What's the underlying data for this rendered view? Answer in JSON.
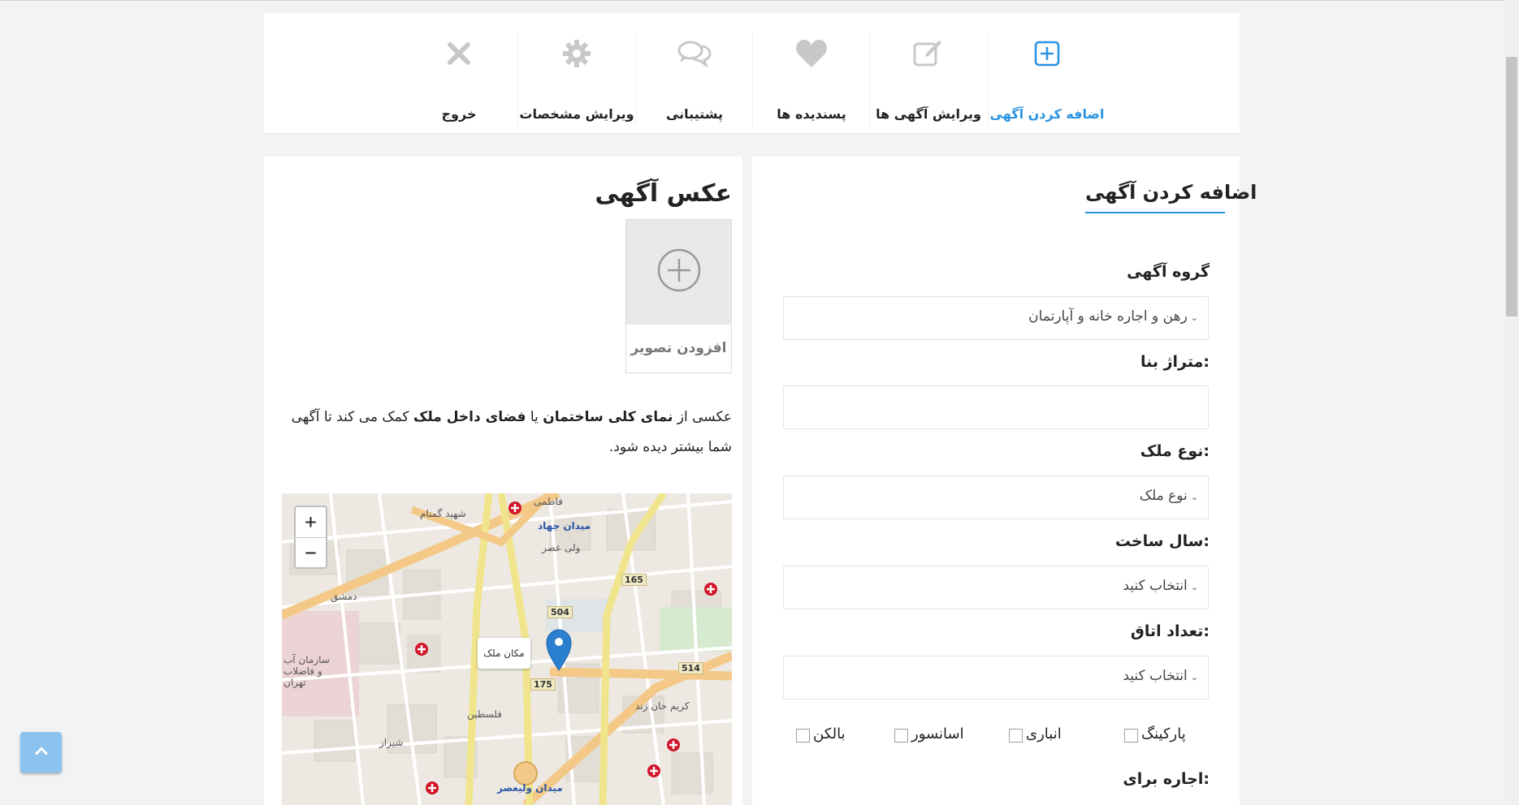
{
  "nav": {
    "items": [
      {
        "label": "اضافه کردن آگهی",
        "icon": "plus-square-icon",
        "active": true
      },
      {
        "label": "ویرایش آگهی ها",
        "icon": "edit-icon",
        "active": false
      },
      {
        "label": "پسندیده ها",
        "icon": "heart-icon",
        "active": false
      },
      {
        "label": "پشتیبانی",
        "icon": "chat-icon",
        "active": false
      },
      {
        "label": "ویرایش مشخصات",
        "icon": "gear-icon",
        "active": false
      },
      {
        "label": "خروج",
        "icon": "close-icon",
        "active": false
      }
    ]
  },
  "form": {
    "title": "اضافه کردن آگهی",
    "group_label": "گروه آگهی",
    "group_value": "رهن و اجاره خانه و آپارتمان",
    "area_label": "متراژ بنا:",
    "area_value": "",
    "type_label": "نوع ملک:",
    "type_value": "نوع ملک",
    "year_label": "سال ساخت:",
    "year_value": "انتخاب کنید",
    "rooms_label": "تعداد اتاق:",
    "rooms_value": "انتخاب کنید",
    "checks": [
      "پارکینگ",
      "انباری",
      "اسانسور",
      "بالکن"
    ],
    "rent_label": "اجاره برای:"
  },
  "photo": {
    "title": "عکس آگهی",
    "upload_label": "افزودن تصویر",
    "desc_1": "عکسی از ",
    "desc_2": "نمای کلی ساختمان",
    "desc_3": " یا ",
    "desc_4": "فضای داخل ملک",
    "desc_5": " کمک می کند تا آگهی شما بیشتر دیده شود."
  },
  "map": {
    "zoom_in": "+",
    "zoom_out": "−",
    "tooltip": "مکان ملک",
    "squares": [
      "میدان جهاد",
      "میدان ولیعصر"
    ],
    "labels": [
      "فاطمی",
      "شهید گمنام",
      "ولی عصر",
      "فلسطین",
      "کریم خان زند",
      "سازمان آب و فاضلاب تهران",
      "دمشق",
      "شیراز"
    ],
    "road_numbers": [
      "165",
      "504",
      "175",
      "514"
    ]
  },
  "colors": {
    "accent": "#2a93e2",
    "totop": "#8cc3ee"
  }
}
